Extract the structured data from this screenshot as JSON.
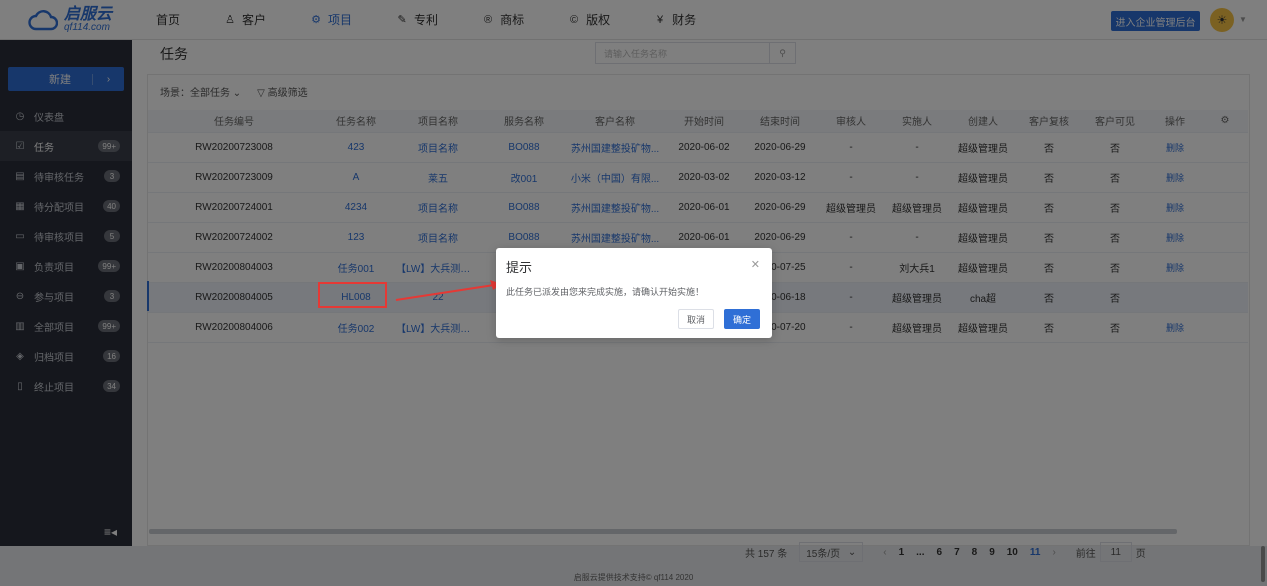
{
  "logo": {
    "name": "启服云",
    "sub": "qf114.com"
  },
  "nav": [
    {
      "label": "首页",
      "icon": ""
    },
    {
      "label": "客户",
      "icon": "people-icon"
    },
    {
      "label": "项目",
      "icon": "project-icon"
    },
    {
      "label": "专利",
      "icon": "patent-icon"
    },
    {
      "label": "商标",
      "icon": "trademark-icon"
    },
    {
      "label": "版权",
      "icon": "copyright-icon"
    },
    {
      "label": "财务",
      "icon": "finance-icon"
    }
  ],
  "header": {
    "enter_admin": "进入企业管理后台"
  },
  "sidebar": {
    "new_label": "新建",
    "items": [
      {
        "label": "仪表盘",
        "badge": ""
      },
      {
        "label": "任务",
        "badge": "99+"
      },
      {
        "label": "待审核任务",
        "badge": "3"
      },
      {
        "label": "待分配项目",
        "badge": "40"
      },
      {
        "label": "待审核项目",
        "badge": "5"
      },
      {
        "label": "负责项目",
        "badge": "99+"
      },
      {
        "label": "参与项目",
        "badge": "3"
      },
      {
        "label": "全部项目",
        "badge": "99+"
      },
      {
        "label": "归档项目",
        "badge": "16"
      },
      {
        "label": "终止项目",
        "badge": "34"
      }
    ]
  },
  "page": {
    "title": "任务",
    "search_placeholder": "请输入任务名称",
    "filter_scene": "场景：全部任务",
    "filter_advanced": "高级筛选"
  },
  "table": {
    "headers": [
      "任务编号",
      "任务名称",
      "项目名称",
      "服务名称",
      "客户名称",
      "开始时间",
      "结束时间",
      "审核人",
      "实施人",
      "创建人",
      "客户复核",
      "客户可见",
      "操作"
    ],
    "rows": [
      [
        "RW20200723008",
        "423",
        "项目名称",
        "BO088",
        "苏州国建整投矿物...",
        "2020-06-02",
        "2020-06-29",
        "-",
        "-",
        "超级管理员",
        "否",
        "否",
        "删除"
      ],
      [
        "RW20200723009",
        "A",
        "莱五",
        "改001",
        "小米（中国）有限...",
        "2020-03-02",
        "2020-03-12",
        "-",
        "-",
        "超级管理员",
        "否",
        "否",
        "删除"
      ],
      [
        "RW20200724001",
        "4234",
        "项目名称",
        "BO088",
        "苏州国建整投矿物...",
        "2020-06-01",
        "2020-06-29",
        "超级管理员",
        "超级管理员",
        "超级管理员",
        "否",
        "否",
        "删除"
      ],
      [
        "RW20200724002",
        "123",
        "项目名称",
        "BO088",
        "苏州国建整投矿物...",
        "2020-06-01",
        "2020-06-29",
        "-",
        "-",
        "超级管理员",
        "否",
        "否",
        "删除"
      ],
      [
        "RW20200804003",
        "任务001",
        "【LW】大兵测试项目",
        "",
        "",
        "",
        "2020-07-25",
        "-",
        "刘大兵1",
        "超级管理员",
        "否",
        "否",
        "删除"
      ],
      [
        "RW20200804005",
        "HL008",
        "22",
        "",
        "",
        "",
        "2020-06-18",
        "-",
        "超级管理员",
        "cha超",
        "否",
        "否",
        ""
      ],
      [
        "RW20200804006",
        "任务002",
        "【LW】大兵测试项目",
        "",
        "",
        "",
        "2020-07-20",
        "-",
        "超级管理员",
        "超级管理员",
        "否",
        "否",
        "删除"
      ]
    ]
  },
  "pager": {
    "total": "共 157 条",
    "size": "15条/页",
    "pages": [
      "1",
      "...",
      "6",
      "7",
      "8",
      "9",
      "10",
      "11"
    ],
    "current": "11",
    "goto_label": "前往",
    "goto_value": "11",
    "goto_suffix": "页"
  },
  "footer": "启服云提供技术支持© qf114 2020",
  "modal": {
    "title": "提示",
    "message": "此任务已派发由您来完成实施，请确认开始实施！",
    "cancel": "取消",
    "ok": "确定"
  },
  "colors": {
    "accent": "#2f6fd6",
    "highlight": "#e53935",
    "sidebar": "#2b2f3a"
  }
}
